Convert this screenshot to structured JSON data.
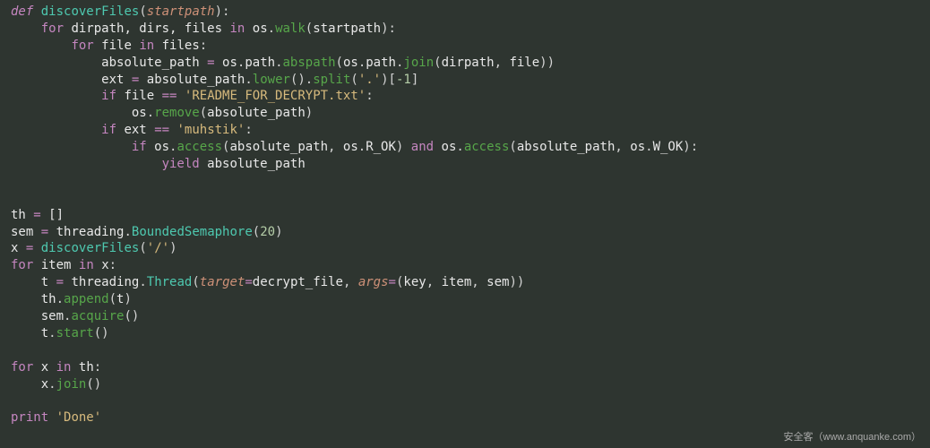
{
  "code": {
    "l1": {
      "def": "def",
      "fn": "discoverFiles",
      "param": "startpath"
    },
    "l2": {
      "for": "for",
      "vars": "dirpath, dirs, files",
      "in": "in",
      "mod": "os",
      "call": "walk",
      "arg": "startpath"
    },
    "l3": {
      "for": "for",
      "var": "file",
      "in": "in",
      "iter": "files"
    },
    "l4": {
      "lhs": "absolute_path",
      "eq": "=",
      "mod": "os",
      "p": "path",
      "c1": "abspath",
      "c2": "join",
      "a1": "dirpath",
      "a2": "file"
    },
    "l5": {
      "lhs": "ext",
      "eq": "=",
      "src": "absolute_path",
      "c1": "lower",
      "c2": "split",
      "arg": "'.'",
      "idx": "-1"
    },
    "l6": {
      "if": "if",
      "lhs": "file",
      "op": "==",
      "str": "'README_FOR_DECRYPT.txt'"
    },
    "l7": {
      "mod": "os",
      "call": "remove",
      "arg": "absolute_path"
    },
    "l8": {
      "if": "if",
      "lhs": "ext",
      "op": "==",
      "str": "'muhstik'"
    },
    "l9": {
      "if": "if",
      "mod": "os",
      "call": "access",
      "a1": "absolute_path",
      "rok": "R_OK",
      "and": "and",
      "wok": "W_OK"
    },
    "l10": {
      "yield": "yield",
      "v": "absolute_path"
    },
    "l11": {
      "lhs": "th",
      "eq": "=",
      "val": "[]"
    },
    "l12": {
      "lhs": "sem",
      "eq": "=",
      "mod": "threading",
      "call": "BoundedSemaphore",
      "arg": "20"
    },
    "l13": {
      "lhs": "x",
      "eq": "=",
      "call": "discoverFiles",
      "arg": "'/'"
    },
    "l14": {
      "for": "for",
      "var": "item",
      "in": "in",
      "iter": "x"
    },
    "l15": {
      "lhs": "t",
      "eq": "=",
      "mod": "threading",
      "call": "Thread",
      "k1": "target",
      "v1": "decrypt_file",
      "k2": "args",
      "v2a": "key",
      "v2b": "item",
      "v2c": "sem"
    },
    "l16": {
      "obj": "th",
      "call": "append",
      "arg": "t"
    },
    "l17": {
      "obj": "sem",
      "call": "acquire"
    },
    "l18": {
      "obj": "t",
      "call": "start"
    },
    "l19": {
      "for": "for",
      "var": "x",
      "in": "in",
      "iter": "th"
    },
    "l20": {
      "obj": "x",
      "call": "join"
    },
    "l21": {
      "print": "print",
      "str": "'Done'"
    }
  },
  "watermark": "安全客（www.anquanke.com）"
}
